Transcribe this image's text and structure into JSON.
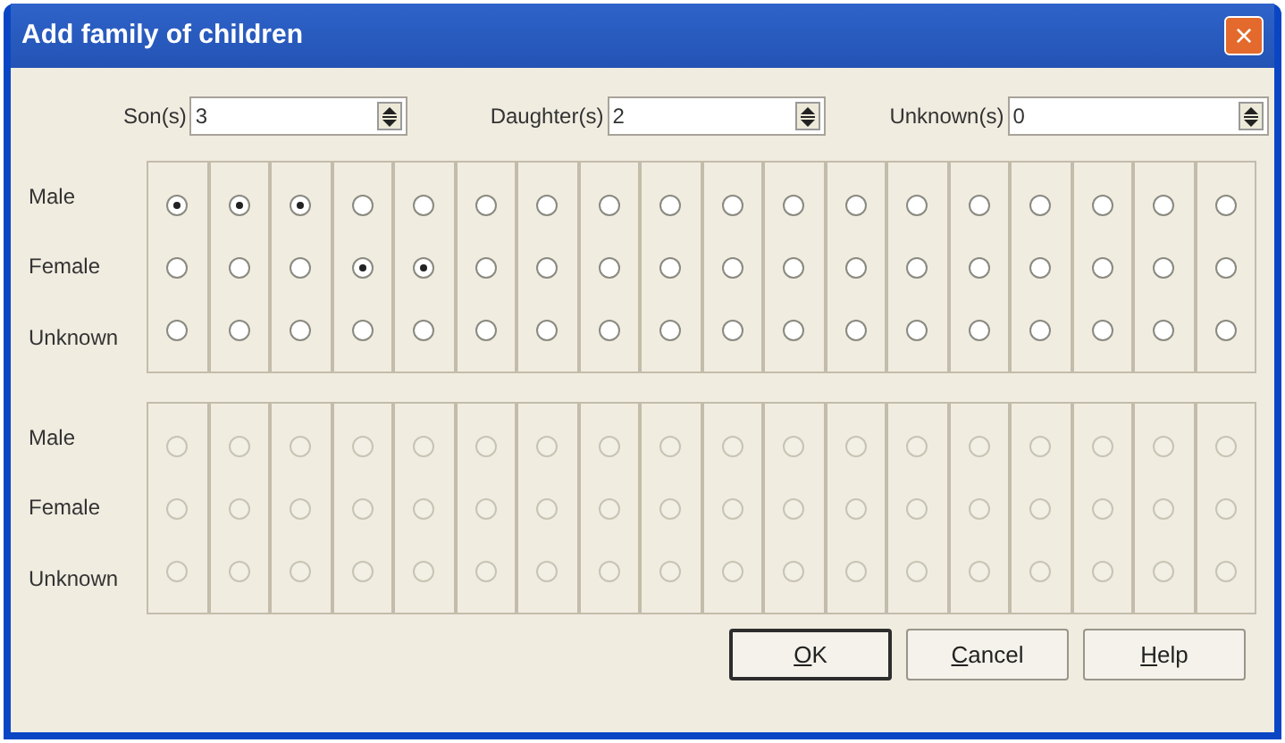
{
  "window": {
    "title": "Add family of children",
    "close": "×"
  },
  "counts": [
    {
      "label": "Son(s)",
      "value": "3"
    },
    {
      "label": "Daughter(s)",
      "value": "2"
    },
    {
      "label": "Unknown(s)",
      "value": "0"
    }
  ],
  "groups": [
    {
      "disabled": false,
      "row_labels": [
        "Male",
        "Female",
        "Unknown"
      ],
      "columns": [
        [
          {
            "selected": true
          },
          {
            "selected": false
          },
          {
            "selected": false
          }
        ],
        [
          {
            "selected": true
          },
          {
            "selected": false
          },
          {
            "selected": false
          }
        ],
        [
          {
            "selected": true
          },
          {
            "selected": false
          },
          {
            "selected": false
          }
        ],
        [
          {
            "selected": false
          },
          {
            "selected": true
          },
          {
            "selected": false
          }
        ],
        [
          {
            "selected": false
          },
          {
            "selected": true
          },
          {
            "selected": false
          }
        ],
        [
          {
            "selected": false
          },
          {
            "selected": false
          },
          {
            "selected": false
          }
        ],
        [
          {
            "selected": false
          },
          {
            "selected": false
          },
          {
            "selected": false
          }
        ],
        [
          {
            "selected": false
          },
          {
            "selected": false
          },
          {
            "selected": false
          }
        ],
        [
          {
            "selected": false
          },
          {
            "selected": false
          },
          {
            "selected": false
          }
        ],
        [
          {
            "selected": false
          },
          {
            "selected": false
          },
          {
            "selected": false
          }
        ],
        [
          {
            "selected": false
          },
          {
            "selected": false
          },
          {
            "selected": false
          }
        ],
        [
          {
            "selected": false
          },
          {
            "selected": false
          },
          {
            "selected": false
          }
        ],
        [
          {
            "selected": false
          },
          {
            "selected": false
          },
          {
            "selected": false
          }
        ],
        [
          {
            "selected": false
          },
          {
            "selected": false
          },
          {
            "selected": false
          }
        ],
        [
          {
            "selected": false
          },
          {
            "selected": false
          },
          {
            "selected": false
          }
        ],
        [
          {
            "selected": false
          },
          {
            "selected": false
          },
          {
            "selected": false
          }
        ],
        [
          {
            "selected": false
          },
          {
            "selected": false
          },
          {
            "selected": false
          }
        ],
        [
          {
            "selected": false
          },
          {
            "selected": false
          },
          {
            "selected": false
          }
        ]
      ]
    },
    {
      "disabled": true,
      "row_labels": [
        "Male",
        "Female",
        "Unknown"
      ],
      "columns": [
        [
          {
            "selected": false
          },
          {
            "selected": false
          },
          {
            "selected": false
          }
        ],
        [
          {
            "selected": false
          },
          {
            "selected": false
          },
          {
            "selected": false
          }
        ],
        [
          {
            "selected": false
          },
          {
            "selected": false
          },
          {
            "selected": false
          }
        ],
        [
          {
            "selected": false
          },
          {
            "selected": false
          },
          {
            "selected": false
          }
        ],
        [
          {
            "selected": false
          },
          {
            "selected": false
          },
          {
            "selected": false
          }
        ],
        [
          {
            "selected": false
          },
          {
            "selected": false
          },
          {
            "selected": false
          }
        ],
        [
          {
            "selected": false
          },
          {
            "selected": false
          },
          {
            "selected": false
          }
        ],
        [
          {
            "selected": false
          },
          {
            "selected": false
          },
          {
            "selected": false
          }
        ],
        [
          {
            "selected": false
          },
          {
            "selected": false
          },
          {
            "selected": false
          }
        ],
        [
          {
            "selected": false
          },
          {
            "selected": false
          },
          {
            "selected": false
          }
        ],
        [
          {
            "selected": false
          },
          {
            "selected": false
          },
          {
            "selected": false
          }
        ],
        [
          {
            "selected": false
          },
          {
            "selected": false
          },
          {
            "selected": false
          }
        ],
        [
          {
            "selected": false
          },
          {
            "selected": false
          },
          {
            "selected": false
          }
        ],
        [
          {
            "selected": false
          },
          {
            "selected": false
          },
          {
            "selected": false
          }
        ],
        [
          {
            "selected": false
          },
          {
            "selected": false
          },
          {
            "selected": false
          }
        ],
        [
          {
            "selected": false
          },
          {
            "selected": false
          },
          {
            "selected": false
          }
        ],
        [
          {
            "selected": false
          },
          {
            "selected": false
          },
          {
            "selected": false
          }
        ],
        [
          {
            "selected": false
          },
          {
            "selected": false
          },
          {
            "selected": false
          }
        ]
      ]
    }
  ],
  "buttons": [
    {
      "mnemonic": "O",
      "rest": "K",
      "default": true
    },
    {
      "mnemonic": "C",
      "rest": "ancel",
      "default": false
    },
    {
      "mnemonic": "H",
      "rest": "elp",
      "default": false
    }
  ]
}
